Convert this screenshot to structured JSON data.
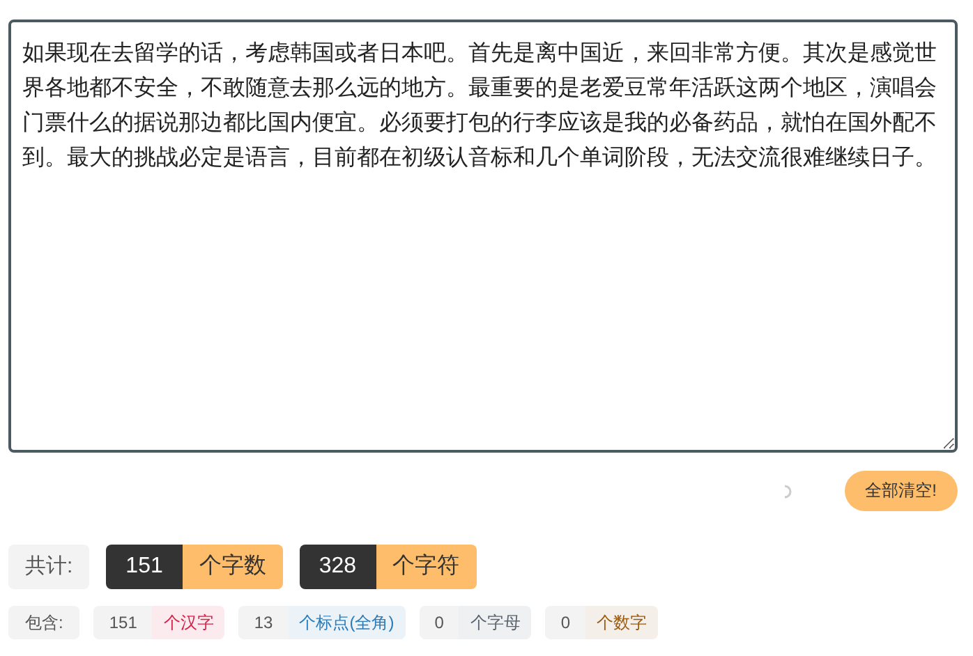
{
  "editor": {
    "value": "如果现在去留学的话，考虑韩国或者日本吧。首先是离中国近，来回非常方便。其次是感觉世界各地都不安全，不敢随意去那么远的地方。最重要的是老爱豆常年活跃这两个地区，演唱会门票什么的据说那边都比国内便宜。必须要打包的行李应该是我的必备药品，就怕在国外配不到。最大的挑战必定是语言，目前都在初级认音标和几个单词阶段，无法交流很难继续日子。"
  },
  "clear_button": {
    "label": "全部清空!"
  },
  "totals": {
    "label": "共计:",
    "items": [
      {
        "count": "151",
        "unit": "个字数"
      },
      {
        "count": "328",
        "unit": "个字符"
      }
    ]
  },
  "breakdown": {
    "label": "包含:",
    "items": [
      {
        "count": "151",
        "unit": "个汉字",
        "color": "#d6224a"
      },
      {
        "count": "13",
        "unit": "个标点(全角)",
        "color": "#2b7bb9"
      },
      {
        "count": "0",
        "unit": "个字母",
        "color": "#5a6470"
      },
      {
        "count": "0",
        "unit": "个数字",
        "color": "#9a5a10"
      }
    ]
  }
}
